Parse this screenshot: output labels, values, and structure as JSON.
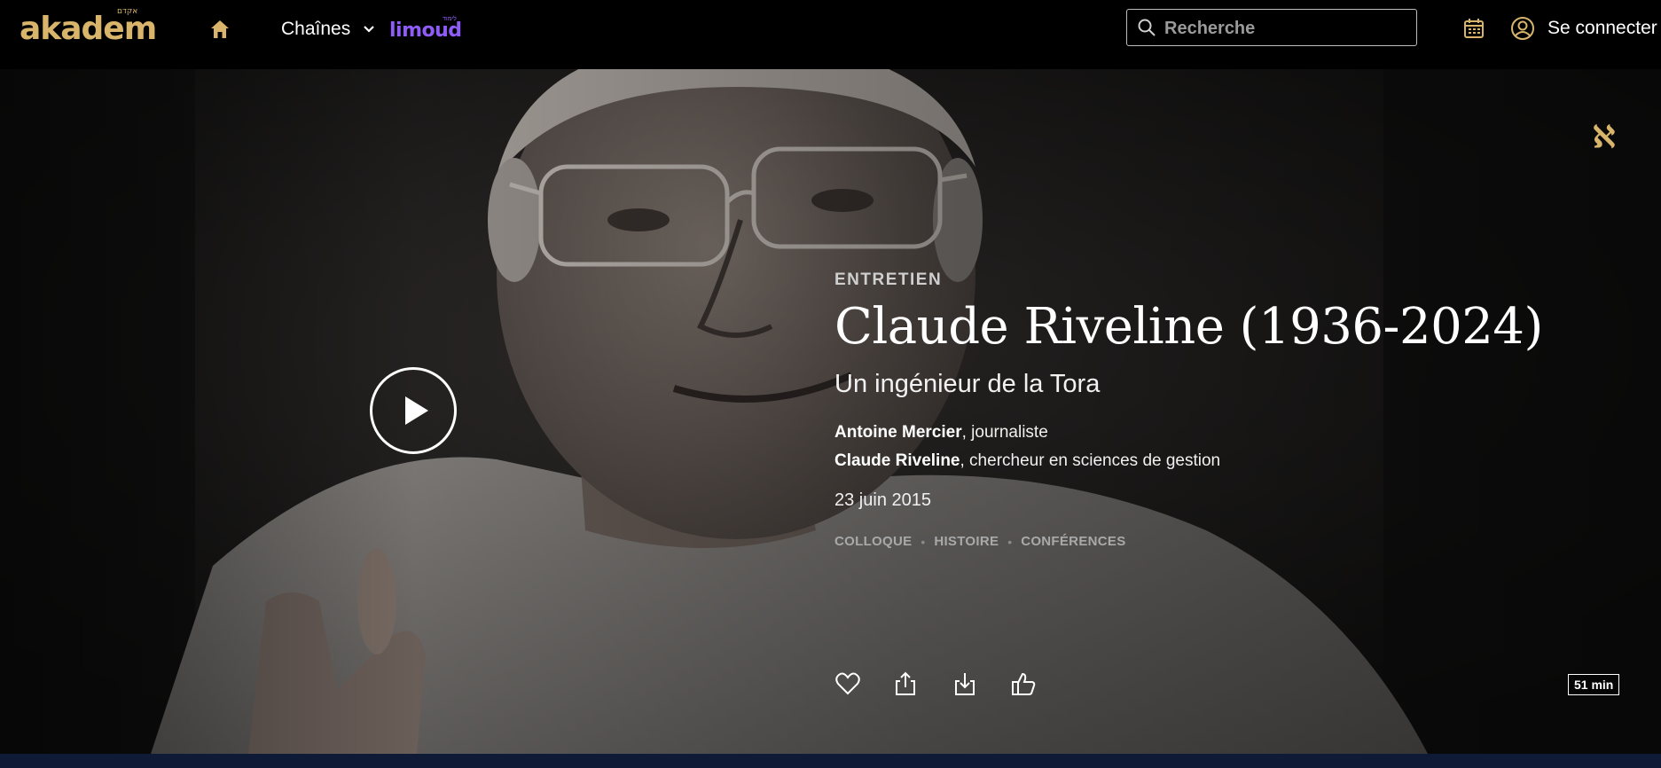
{
  "header": {
    "logo_text": "akadem",
    "logo_hebrew": "אקדם",
    "home_icon": "home-icon",
    "channels_label": "Chaînes",
    "limoud_text": "limoud",
    "limoud_hebrew": "לימוד",
    "search_placeholder": "Recherche",
    "search_value": "",
    "calendar_icon": "calendar-icon",
    "login_label": "Se connecter",
    "accent_color": "#d8b56b",
    "limoud_color": "#8e5cf7"
  },
  "hero": {
    "kind": "ENTRETIEN",
    "title": "Claude Riveline (1936-2024)",
    "subtitle": "Un ingénieur de la Tora",
    "people": [
      {
        "name": "Antoine Mercier",
        "role": ", journaliste"
      },
      {
        "name": "Claude Riveline",
        "role": ", chercheur en sciences de gestion"
      }
    ],
    "date": "23 juin 2015",
    "tags": [
      "COLLOQUE",
      "HISTOIRE",
      "CONFÉRENCES"
    ],
    "duration": "51 min",
    "alef_mark": "ℵ",
    "actions": [
      "heart-icon",
      "share-icon",
      "download-icon",
      "thumbs-up-icon"
    ]
  }
}
